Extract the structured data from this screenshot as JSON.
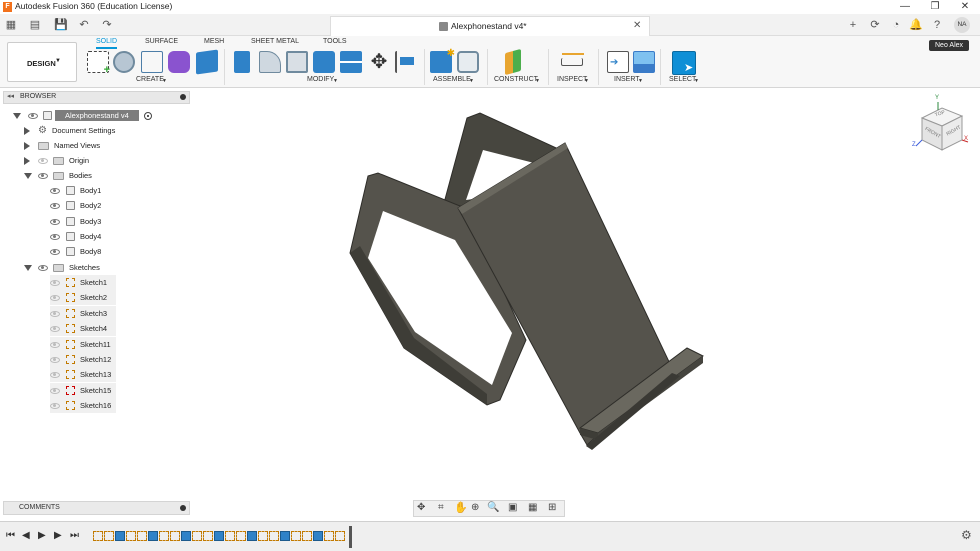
{
  "app": {
    "title": "Autodesk Fusion 360 (Education License)",
    "logo_letter": "F"
  },
  "document": {
    "tab_title": "Alexphonestand v4*",
    "user_initials": "NA",
    "user_name": "Neo Alex"
  },
  "ribbon": {
    "workspace": "DESIGN",
    "tabs": [
      "SOLID",
      "SURFACE",
      "MESH",
      "SHEET METAL",
      "TOOLS"
    ],
    "active_tab": "SOLID",
    "groups": [
      "CREATE",
      "MODIFY",
      "ASSEMBLE",
      "CONSTRUCT",
      "INSPECT",
      "INSERT",
      "SELECT"
    ]
  },
  "browser": {
    "title": "BROWSER",
    "root": "Alexphonestand v4",
    "items": {
      "document_settings": "Document Settings",
      "named_views": "Named Views",
      "origin": "Origin",
      "bodies": "Bodies",
      "sketches": "Sketches"
    },
    "bodies": [
      "Body1",
      "Body2",
      "Body3",
      "Body4",
      "Body8"
    ],
    "sketches": [
      "Sketch1",
      "Sketch2",
      "Sketch3",
      "Sketch4",
      "Sketch11",
      "Sketch12",
      "Sketch13",
      "Sketch15",
      "Sketch16"
    ]
  },
  "comments": {
    "title": "COMMENTS"
  },
  "viewcube": {
    "top": "TOP",
    "front": "FRONT",
    "right": "RIGHT",
    "axis_x": "X",
    "axis_y": "Y",
    "axis_z": "Z"
  },
  "colors": {
    "accent": "#0696d7",
    "model": "#55534c",
    "model_dark": "#3a3934",
    "model_light": "#6a685f"
  },
  "timeline": {
    "feature_count": 23
  }
}
